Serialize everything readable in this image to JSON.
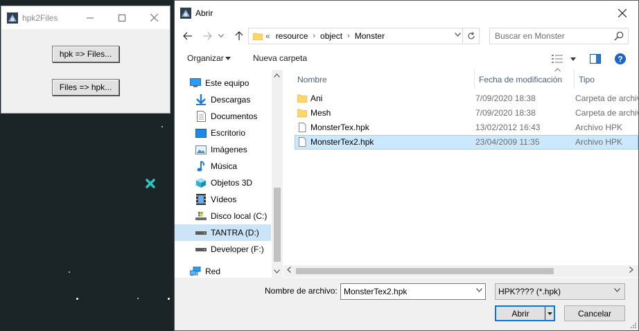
{
  "small_window": {
    "title": "hpk2Files",
    "buttons": [
      "hpk => Files...",
      "Files => hpk..."
    ]
  },
  "dialog": {
    "title": "Abrir",
    "breadcrumb": [
      "«",
      "resource",
      "object",
      "Monster"
    ],
    "search_placeholder": "Buscar en Monster",
    "toolbar": {
      "organize": "Organizar",
      "new_folder": "Nueva carpeta"
    },
    "nav_items": [
      {
        "label": "Este equipo",
        "icon": "computer-icon"
      },
      {
        "label": "Descargas",
        "icon": "download-arrow-icon"
      },
      {
        "label": "Documentos",
        "icon": "document-icon"
      },
      {
        "label": "Escritorio",
        "icon": "desktop-icon"
      },
      {
        "label": "Imágenes",
        "icon": "pictures-icon"
      },
      {
        "label": "Música",
        "icon": "music-note-icon"
      },
      {
        "label": "Objetos 3D",
        "icon": "cube-icon"
      },
      {
        "label": "Vídeos",
        "icon": "film-icon"
      },
      {
        "label": "Disco local (C:)",
        "icon": "drive-icon"
      },
      {
        "label": "TANTRA (D:)",
        "icon": "drive-icon"
      },
      {
        "label": "Developer (F:)",
        "icon": "drive-icon"
      },
      {
        "label": "Red",
        "icon": "network-icon"
      }
    ],
    "selected_nav": "TANTRA (D:)",
    "columns": [
      "Nombre",
      "Fecha de modificación",
      "Tipo"
    ],
    "files": [
      {
        "name": "Ani",
        "date": "7/09/2020 18:38",
        "type": "Carpeta de archivos",
        "kind": "folder"
      },
      {
        "name": "Mesh",
        "date": "7/09/2020 18:38",
        "type": "Carpeta de archivos",
        "kind": "folder"
      },
      {
        "name": "MonsterTex.hpk",
        "date": "13/02/2012 16:43",
        "type": "Archivo HPK",
        "kind": "file"
      },
      {
        "name": "MonsterTex2.hpk",
        "date": "23/04/2009 11:35",
        "type": "Archivo HPK",
        "kind": "file"
      }
    ],
    "selected_file": "MonsterTex2.hpk",
    "filename_label": "Nombre de archivo:",
    "filename_value": "MonsterTex2.hpk",
    "filter_value": "HPK???? (*.hpk)",
    "open_button": "Abrir",
    "cancel_button": "Cancelar"
  },
  "colors": {
    "selection": "#cce8ff",
    "nav_selection": "#cce4f7",
    "accent": "#0078d7",
    "folder": "#ffd766"
  }
}
